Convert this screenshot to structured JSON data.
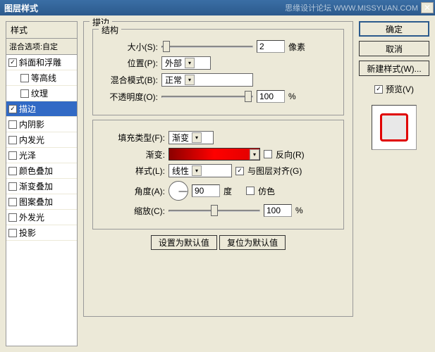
{
  "title": "图层样式",
  "watermark": "思缘设计论坛  WWW.MISSYUAN.COM",
  "styles_panel": {
    "header": "样式",
    "blend_opts": "混合选项:自定",
    "items": [
      {
        "label": "斜面和浮雕",
        "checked": true,
        "selected": false
      },
      {
        "label": "等高线",
        "checked": false,
        "child": true
      },
      {
        "label": "纹理",
        "checked": false,
        "child": true
      },
      {
        "label": "描边",
        "checked": true,
        "selected": true
      },
      {
        "label": "内阴影",
        "checked": false
      },
      {
        "label": "内发光",
        "checked": false
      },
      {
        "label": "光泽",
        "checked": false
      },
      {
        "label": "颜色叠加",
        "checked": false
      },
      {
        "label": "渐变叠加",
        "checked": false
      },
      {
        "label": "图案叠加",
        "checked": false
      },
      {
        "label": "外发光",
        "checked": false
      },
      {
        "label": "投影",
        "checked": false
      }
    ]
  },
  "stroke": {
    "section": "描边",
    "structure": "结构",
    "size_label": "大小(S):",
    "size_value": "2",
    "size_unit": "像素",
    "position_label": "位置(P):",
    "position_value": "外部",
    "blend_label": "混合模式(B):",
    "blend_value": "正常",
    "opacity_label": "不透明度(O):",
    "opacity_value": "100",
    "opacity_unit": "%",
    "fill_type_label": "填充类型(F):",
    "fill_type_value": "渐变",
    "gradient_label": "渐变:",
    "reverse_label": "反向(R)",
    "style_label": "样式(L):",
    "style_value": "线性",
    "align_label": "与图层对齐(G)",
    "angle_label": "角度(A):",
    "angle_value": "90",
    "angle_unit": "度",
    "dither_label": "仿色",
    "scale_label": "缩放(C):",
    "scale_value": "100",
    "scale_unit": "%",
    "btn_default": "设置为默认值",
    "btn_reset": "复位为默认值"
  },
  "buttons": {
    "ok": "确定",
    "cancel": "取消",
    "new_style": "新建样式(W)...",
    "preview": "预览(V)"
  }
}
